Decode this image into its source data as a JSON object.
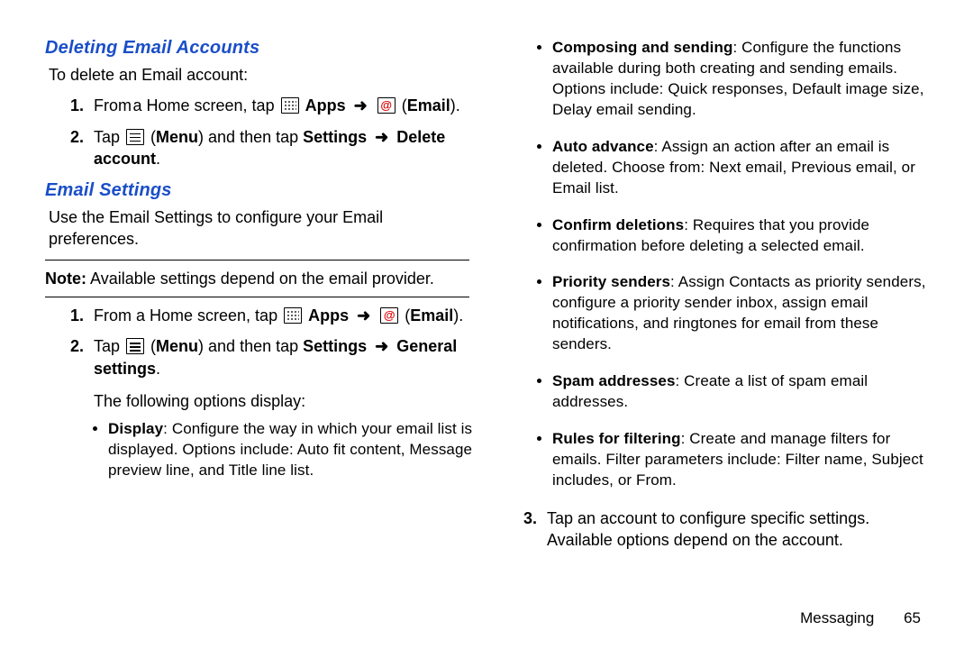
{
  "left": {
    "heading1": "Deleting Email Accounts",
    "intro1": "To delete an Email account:",
    "steps1": {
      "s1a": "From a Home screen, tap ",
      "s1b_apps": "Apps",
      "s1c_email": "Email",
      "s2a": "Tap ",
      "s2b_menu": "Menu",
      "s2c": " and then tap ",
      "s2d_settings": "Settings",
      "s2e_delete": "Delete account",
      "arrow": "➜"
    },
    "heading2": "Email Settings",
    "intro2": "Use the Email Settings to configure your Email preferences.",
    "note_label": "Note:",
    "note_text": " Available settings depend on the email provider.",
    "steps2": {
      "s1a": "From a Home screen, tap ",
      "s1b_apps": "Apps",
      "s1c_email": "Email",
      "s2a": "Tap ",
      "s2b_menu": "Menu",
      "s2c": " and then tap ",
      "s2d_settings": "Settings",
      "s2e_general": "General settings",
      "arrow": "➜"
    },
    "followup": "The following options display:",
    "bullets1": {
      "b1_title": "Display",
      "b1_body": ": Configure the way in which your email list is displayed. Options include: Auto fit content, Message preview line, and Title line list."
    }
  },
  "right": {
    "bullets2": {
      "b1_title": "Composing and sending",
      "b1_body": ": Configure the functions available during both creating and sending emails. Options include: Quick responses, Default image size, Delay email sending.",
      "b2_title": "Auto advance",
      "b2_body": ": Assign an action after an email is deleted. Choose from: Next email, Previous email, or Email list.",
      "b3_title": "Confirm deletions",
      "b3_body": ": Requires that you provide confirmation before deleting a selected email.",
      "b4_title": "Priority senders",
      "b4_body": ": Assign Contacts as priority senders, configure a priority sender inbox, assign email notifications, and ringtones for email from these senders.",
      "b5_title": "Spam addresses",
      "b5_body": ": Create a list of spam email addresses.",
      "b6_title": "Rules for filtering",
      "b6_body": ": Create and manage filters for emails. Filter parameters include: Filter name, Subject includes, or From."
    },
    "step3": "Tap an account to configure specific settings. Available options depend on the account."
  },
  "footer": {
    "section": "Messaging",
    "page": "65"
  }
}
